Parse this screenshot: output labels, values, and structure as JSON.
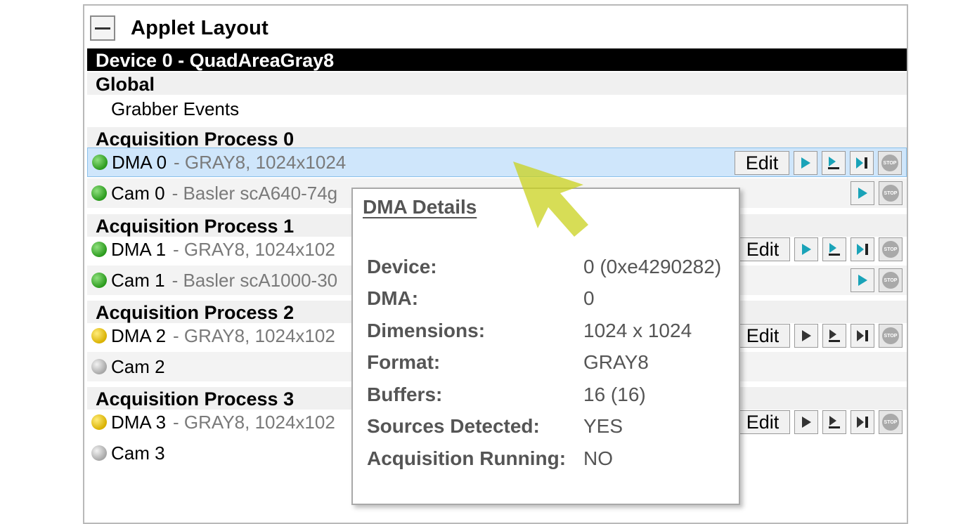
{
  "panel": {
    "title": "Applet Layout",
    "collapse_symbol": "—"
  },
  "device": "Device 0 - QuadAreaGray8",
  "global": {
    "header": "Global",
    "item": "Grabber Events"
  },
  "processes": [
    {
      "header": "Acquisition Process 0",
      "dma": {
        "name": "DMA 0",
        "detail": "- GRAY8, 1024x1024",
        "led": "green"
      },
      "cam": {
        "name": "Cam 0",
        "detail": "- Basler scA640-74g",
        "led": "green"
      }
    },
    {
      "header": "Acquisition Process 1",
      "dma": {
        "name": "DMA 1",
        "detail": "- GRAY8, 1024x102",
        "led": "green"
      },
      "cam": {
        "name": "Cam 1",
        "detail": "- Basler scA1000-30",
        "led": "green"
      }
    },
    {
      "header": "Acquisition Process 2",
      "dma": {
        "name": "DMA 2",
        "detail": "- GRAY8, 1024x102",
        "led": "yellow"
      },
      "cam": {
        "name": "Cam 2",
        "detail": "",
        "led": "gray"
      }
    },
    {
      "header": "Acquisition Process 3",
      "dma": {
        "name": "DMA 3",
        "detail": "- GRAY8, 1024x102",
        "led": "yellow"
      },
      "cam": {
        "name": "Cam 3",
        "detail": "",
        "led": "gray"
      }
    }
  ],
  "buttons": {
    "edit": "Edit",
    "stop": "STOP"
  },
  "tooltip": {
    "title": "DMA Details",
    "rows": [
      {
        "label": "Device:",
        "value": "0 (0xe4290282)"
      },
      {
        "label": "DMA:",
        "value": "0"
      },
      {
        "label": "Dimensions:",
        "value": "1024 x 1024"
      },
      {
        "label": "Format:",
        "value": "GRAY8"
      },
      {
        "label": "Buffers:",
        "value": "16 (16)"
      },
      {
        "label": "Sources Detected:",
        "value": "YES"
      },
      {
        "label": "Acquisition Running:",
        "value": "NO"
      }
    ]
  },
  "colors": {
    "selected_row": "#cfe6fb",
    "play_active": "#1aa3b8",
    "play_inactive": "#333333",
    "led_green": "#2a9a1c",
    "led_yellow": "#d9b100",
    "cursor": "#c9d21e"
  },
  "icons": [
    "minus-icon",
    "play-icon",
    "snapshot-icon",
    "step-icon",
    "stop-icon",
    "pointer-arrow-icon"
  ]
}
